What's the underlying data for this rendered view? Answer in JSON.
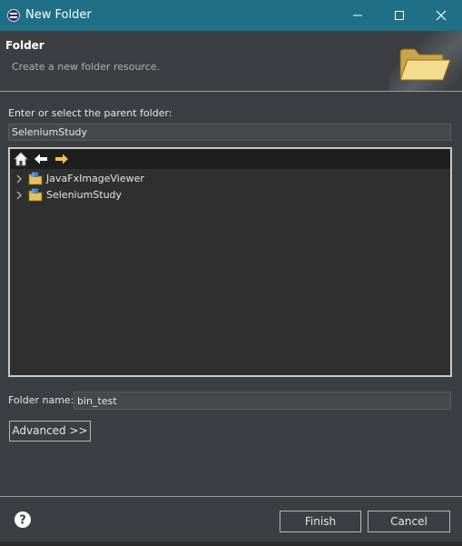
{
  "window": {
    "title": "New Folder",
    "icon": "eclipse-app-icon",
    "controls": [
      "minimize-icon",
      "maximize-icon",
      "close-icon"
    ]
  },
  "header": {
    "title": "Folder",
    "description": "Create a new folder resource.",
    "banner_icon": "folder-open-icon"
  },
  "parent_folder": {
    "label": "Enter or select the parent folder:",
    "value": "SeleniumStudy"
  },
  "tree": {
    "toolbar": [
      "home-icon",
      "back-arrow-icon",
      "forward-arrow-icon"
    ],
    "items": [
      {
        "label": "JavaFxImageViewer",
        "icon": "java-project-icon",
        "expander": "chevron-right-icon"
      },
      {
        "label": "SeleniumStudy",
        "icon": "java-project-icon",
        "expander": "chevron-right-icon"
      }
    ]
  },
  "folder_name": {
    "label": "Folder name:",
    "value": "bin_test"
  },
  "buttons": {
    "advanced": "Advanced >>",
    "finish": "Finish",
    "cancel": "Cancel",
    "help_icon": "help-icon"
  },
  "colors": {
    "titlebar": "#1f6f86",
    "background": "#3c3f41",
    "tree_background": "#2f2f2f",
    "text": "#e6e6e6"
  }
}
